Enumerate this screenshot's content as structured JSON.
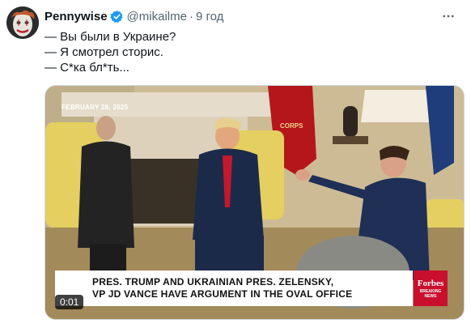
{
  "post": {
    "author_name": "Pennywise",
    "handle": "@mikailme",
    "separator": "·",
    "time_ago": "9 год",
    "lines": [
      "— Вы были в Украине?",
      "— Я смотрел сторис.",
      "— С*ка бл*ть..."
    ]
  },
  "video": {
    "date_overlay": "FEBRUARY 28, 2025",
    "headline_line1": "PRES. TRUMP AND UKRAINIAN PRES. ZELENSKY,",
    "headline_line2": "VP JD VANCE HAVE ARGUMENT IN THE OVAL OFFICE",
    "brand_logo": "Forbes",
    "brand_line1": "BREAKING",
    "brand_line2": "NEWS",
    "flag_text": "CORPS",
    "timestamp": "0:01"
  },
  "colors": {
    "verified_blue": "#1d9bf0",
    "muted_text": "#536471",
    "forbes_red": "#c8102e"
  },
  "icons": {
    "verified": "verified-badge-icon",
    "more": "more-options-icon"
  }
}
